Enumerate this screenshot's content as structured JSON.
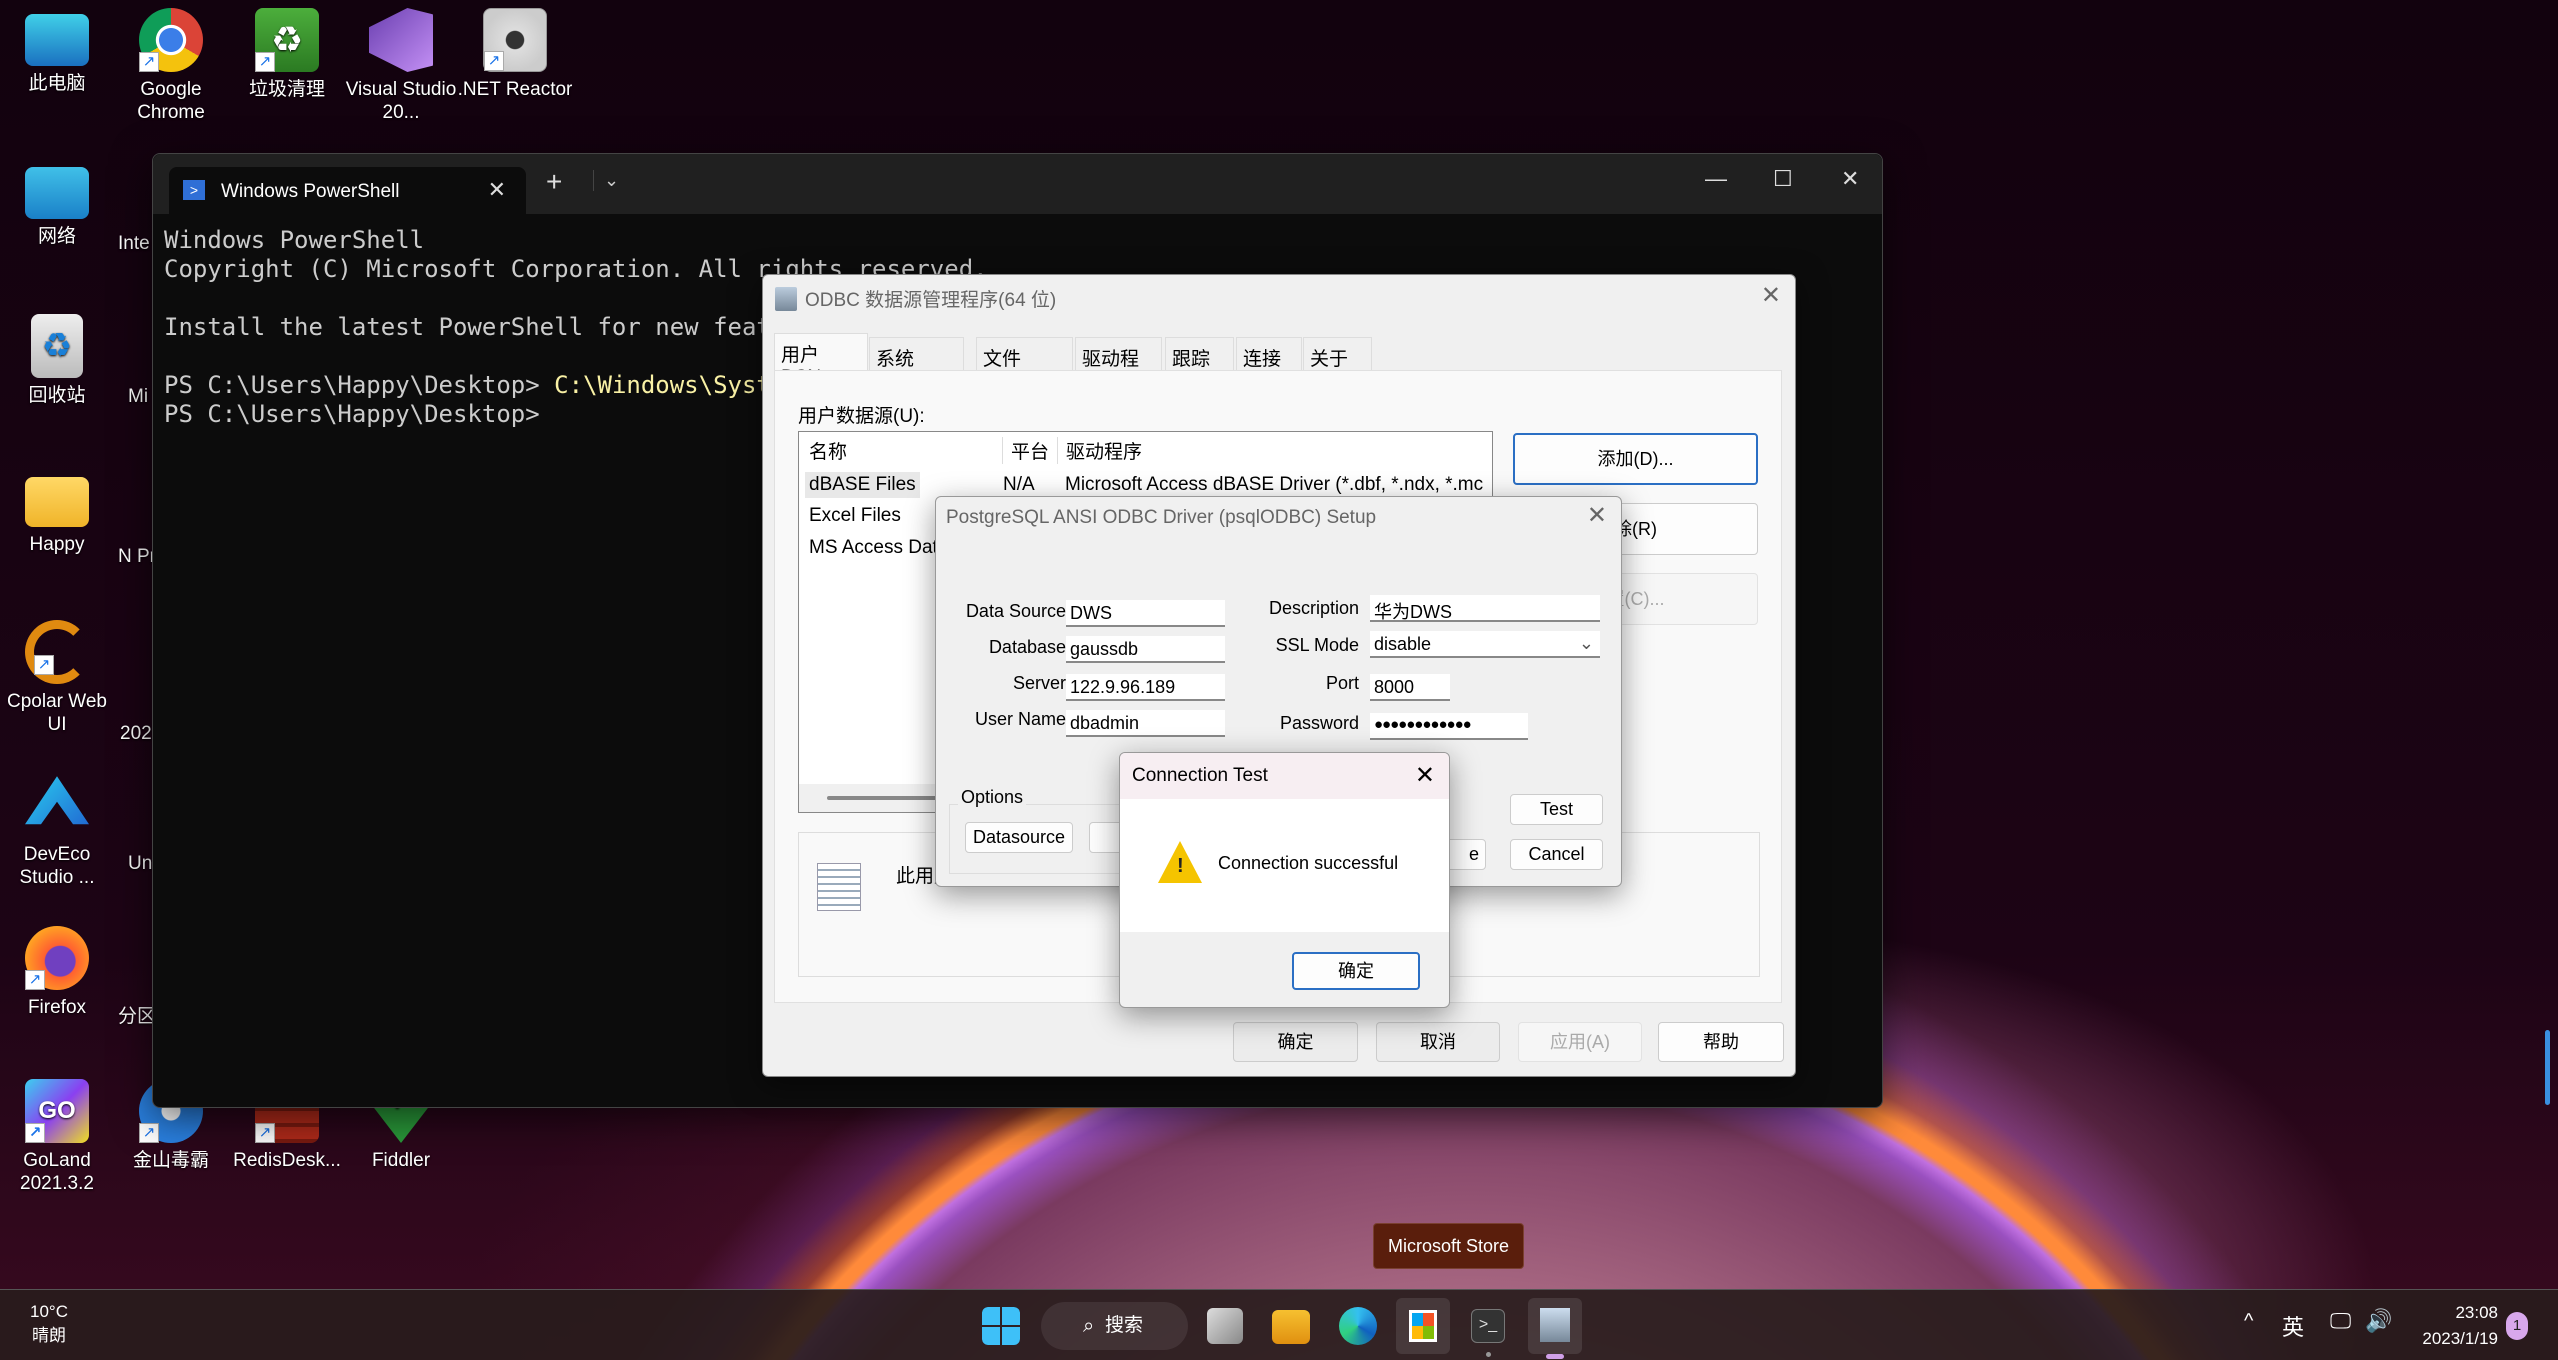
{
  "desktop": {
    "icons": [
      {
        "label": "此电脑",
        "icon": "computer-icon"
      },
      {
        "label": "Google Chrome",
        "icon": "chrome-icon"
      },
      {
        "label": "垃圾清理",
        "icon": "recycle-cleaner-icon"
      },
      {
        "label": "Visual Studio 20...",
        "icon": "visual-studio-icon"
      },
      {
        "label": ".NET Reactor",
        "icon": "net-reactor-icon"
      },
      {
        "label": "网络",
        "icon": "network-icon"
      },
      {
        "label": "回收站",
        "icon": "recycle-bin-icon"
      },
      {
        "label": "Happy",
        "icon": "user-folder-icon"
      },
      {
        "label": "Cpolar Web UI",
        "icon": "cpolar-icon"
      },
      {
        "label": "DevEco Studio ...",
        "icon": "deveco-icon"
      },
      {
        "label": "Firefox",
        "icon": "firefox-icon"
      },
      {
        "label": "GoLand 2021.3.2",
        "icon": "goland-icon"
      },
      {
        "label": "金山毒霸",
        "icon": "kingsoft-antivirus-icon"
      },
      {
        "label": "RedisDesk...",
        "icon": "redis-desktop-icon"
      },
      {
        "label": "Fiddler",
        "icon": "fiddler-icon"
      }
    ],
    "partial_labels": [
      "Inte 20",
      "Mi",
      "N Pren",
      "202",
      "Un",
      "分区"
    ]
  },
  "terminal": {
    "tab_title": "Windows PowerShell",
    "lines": [
      "Windows PowerShell",
      "Copyright (C) Microsoft Corporation. All rights reserved.",
      "",
      "Install the latest PowerShell for new featu"
    ],
    "prompt1": "PS C:\\Users\\Happy\\Desktop> ",
    "command1": "C:\\Windows\\Syste",
    "prompt2": "PS C:\\Users\\Happy\\Desktop>"
  },
  "odbc": {
    "title": "ODBC 数据源管理程序(64 位)",
    "tabs": [
      "用户 DSN",
      "系统 DSN",
      "文件 DSN",
      "驱动程序",
      "跟踪",
      "连接池",
      "关于"
    ],
    "active_tab": "用户 DSN",
    "list_label": "用户数据源(U):",
    "columns": [
      "名称",
      "平台",
      "驱动程序"
    ],
    "rows": [
      {
        "name": "dBASE Files",
        "platform": "N/A",
        "driver": "Microsoft Access dBASE Driver (*.dbf, *.ndx, *.mc"
      },
      {
        "name": "Excel Files",
        "platform": "",
        "driver": ""
      },
      {
        "name": "MS Access Dat",
        "platform": "",
        "driver": ""
      }
    ],
    "add_button": "添加(D)...",
    "remove_button": "除(R)",
    "configure_button": "置(C)...",
    "info_text": "此用户",
    "ok": "确定",
    "cancel": "取消",
    "apply": "应用(A)",
    "help": "帮助"
  },
  "setup": {
    "title": "PostgreSQL ANSI ODBC Driver (psqlODBC) Setup",
    "fields": {
      "data_source": {
        "label": "Data Source",
        "value": "DWS"
      },
      "database": {
        "label": "Database",
        "value": "gaussdb"
      },
      "server": {
        "label": "Server",
        "value": "122.9.96.189"
      },
      "user_name": {
        "label": "User Name",
        "value": "dbadmin"
      },
      "description": {
        "label": "Description",
        "value": "华为DWS"
      },
      "ssl_mode": {
        "label": "SSL Mode",
        "value": "disable"
      },
      "port": {
        "label": "Port",
        "value": "8000"
      },
      "password": {
        "label": "Password",
        "value": "●●●●●●●●●●●●"
      }
    },
    "options_label": "Options",
    "datasource_button": "Datasource",
    "save_button_partial": "e",
    "test_button": "Test",
    "cancel_button": "Cancel"
  },
  "connection_test": {
    "title": "Connection Test",
    "message": "Connection successful",
    "ok": "确定"
  },
  "tooltip": "Microsoft Store",
  "taskbar": {
    "weather_temp": "10°C",
    "weather_desc": "晴朗",
    "search": "搜索",
    "ime": "英",
    "time": "23:08",
    "date": "2023/1/19",
    "notifications": "1"
  }
}
